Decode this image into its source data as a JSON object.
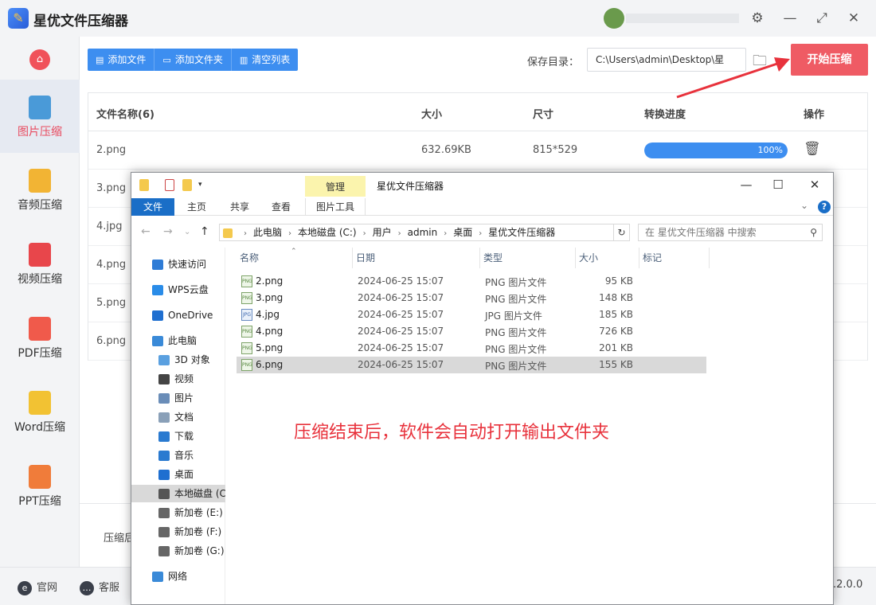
{
  "app": {
    "title": "星优文件压缩器",
    "logo_glyph": "✎",
    "window_controls": [
      "⚙",
      "—",
      "⤢",
      "✕"
    ]
  },
  "sidebar": {
    "home_glyph": "⌂",
    "items": [
      {
        "label": "图片压缩",
        "icon": "image-icon",
        "color": "#4a9ad8",
        "active": true
      },
      {
        "label": "音频压缩",
        "icon": "music-icon",
        "color": "#f2b434",
        "active": false
      },
      {
        "label": "视频压缩",
        "icon": "video-icon",
        "color": "#e8464b",
        "active": false
      },
      {
        "label": "PDF压缩",
        "icon": "pdf-icon",
        "color": "#f05a4b",
        "active": false
      },
      {
        "label": "Word压缩",
        "icon": "word-icon",
        "color": "#f2c233",
        "active": false
      },
      {
        "label": "PPT压缩",
        "icon": "ppt-icon",
        "color": "#f07c3a",
        "active": false
      }
    ]
  },
  "toolbar": {
    "add_file": "添加文件",
    "add_folder": "添加文件夹",
    "clear_list": "清空列表",
    "save_dir_label": "保存目录：",
    "save_dir_value": "C:\\Users\\admin\\Desktop\\星",
    "start_button": "开始压缩"
  },
  "file_table": {
    "headers": {
      "name": "文件名称(6)",
      "size": "大小",
      "dimensions": "尺寸",
      "progress": "转换进度",
      "action": "操作"
    },
    "rows": [
      {
        "name": "2.png",
        "size": "632.69KB",
        "dimensions": "815*529",
        "progress": 1.0,
        "progress_text": "100%"
      },
      {
        "name": "3.png"
      },
      {
        "name": "4.jpg"
      },
      {
        "name": "4.png"
      },
      {
        "name": "5.png"
      },
      {
        "name": "6.png"
      }
    ]
  },
  "footer": {
    "label_partial": "压缩后"
  },
  "bottom_bar": {
    "website": "官网",
    "support": "客服",
    "version": ".2.0.0"
  },
  "explorer": {
    "manage_tab": "管理",
    "window_title": "星优文件压缩器",
    "ribbon_tabs": [
      "文件",
      "主页",
      "共享",
      "查看",
      "图片工具"
    ],
    "address": [
      "此电脑",
      "本地磁盘 (C:)",
      "用户",
      "admin",
      "桌面",
      "星优文件压缩器"
    ],
    "search_placeholder": "在 星优文件压缩器 中搜索",
    "nav_items": [
      {
        "label": "快速访问",
        "icon": "star-icon",
        "color": "#2f7cd6"
      },
      {
        "label": "WPS云盘",
        "icon": "cloud-icon",
        "color": "#2a8ce8"
      },
      {
        "label": "OneDrive",
        "icon": "onedrive-icon",
        "color": "#1f6fd0"
      },
      {
        "label": "此电脑",
        "icon": "computer-icon",
        "color": "#3a8ad8"
      },
      {
        "label": "3D 对象",
        "icon": "cube-icon",
        "color": "#5aa0e0"
      },
      {
        "label": "视频",
        "icon": "film-icon",
        "color": "#444"
      },
      {
        "label": "图片",
        "icon": "picture-icon",
        "color": "#6a8db8"
      },
      {
        "label": "文档",
        "icon": "document-icon",
        "color": "#8aa0b8"
      },
      {
        "label": "下载",
        "icon": "download-icon",
        "color": "#2a7ad0"
      },
      {
        "label": "音乐",
        "icon": "music-note-icon",
        "color": "#2a7ad0"
      },
      {
        "label": "桌面",
        "icon": "desktop-icon",
        "color": "#1f6fd0"
      },
      {
        "label": "本地磁盘 (C",
        "icon": "disk-icon",
        "color": "#555",
        "selected": true
      },
      {
        "label": "新加卷 (E:)",
        "icon": "drive-icon",
        "color": "#666"
      },
      {
        "label": "新加卷 (F:)",
        "icon": "drive-icon",
        "color": "#666"
      },
      {
        "label": "新加卷 (G:)",
        "icon": "drive-icon",
        "color": "#666"
      },
      {
        "label": "网络",
        "icon": "network-icon",
        "color": "#3a8ad8"
      }
    ],
    "columns": [
      "名称",
      "日期",
      "类型",
      "大小",
      "标记"
    ],
    "files": [
      {
        "name": "2.png",
        "date": "2024-06-25 15:07",
        "type": "PNG 图片文件",
        "size": "95 KB",
        "icon": "png-file-icon"
      },
      {
        "name": "3.png",
        "date": "2024-06-25 15:07",
        "type": "PNG 图片文件",
        "size": "148 KB",
        "icon": "png-file-icon"
      },
      {
        "name": "4.jpg",
        "date": "2024-06-25 15:07",
        "type": "JPG 图片文件",
        "size": "185 KB",
        "icon": "jpg-file-icon"
      },
      {
        "name": "4.png",
        "date": "2024-06-25 15:07",
        "type": "PNG 图片文件",
        "size": "726 KB",
        "icon": "png-file-icon"
      },
      {
        "name": "5.png",
        "date": "2024-06-25 15:07",
        "type": "PNG 图片文件",
        "size": "201 KB",
        "icon": "png-file-icon"
      },
      {
        "name": "6.png",
        "date": "2024-06-25 15:07",
        "type": "PNG 图片文件",
        "size": "155 KB",
        "icon": "png-file-icon",
        "selected": true
      }
    ]
  },
  "overlay_caption": "压缩结束后，软件会自动打开输出文件夹"
}
